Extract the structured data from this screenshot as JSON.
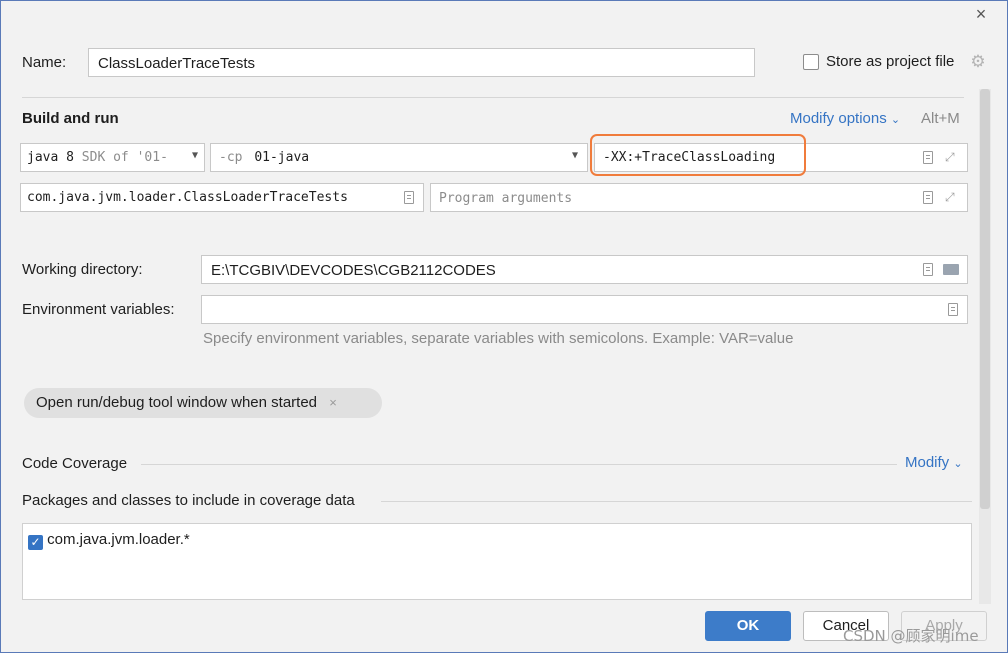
{
  "dialog": {
    "close_glyph": "×",
    "name_label": "Name:",
    "name_value": "ClassLoaderTraceTests",
    "store_label": "Store as project file"
  },
  "build_run": {
    "title": "Build and run",
    "modify_options": "Modify options",
    "shortcut": "Alt+M",
    "jre_label_a": "java 8",
    "jre_label_b": "SDK of '01-",
    "classpath_prefix": "-cp",
    "classpath_value": "01-java",
    "vm_options": "-XX:+TraceClassLoading",
    "main_class": "com.java.jvm.loader.ClassLoaderTraceTests",
    "program_args_placeholder": "Program arguments"
  },
  "working_dir": {
    "label": "Working directory:",
    "value": "E:\\TCGBIV\\DEVCODES\\CGB2112CODES"
  },
  "env_vars": {
    "label": "Environment variables:",
    "value": "",
    "hint": "Specify environment variables, separate variables with semicolons. Example: VAR=value"
  },
  "chip": {
    "label": "Open run/debug tool window when started",
    "close": "×"
  },
  "coverage": {
    "title": "Code Coverage",
    "modify": "Modify",
    "packages_label": "Packages and classes to include in coverage data",
    "items": [
      {
        "checked": true,
        "label": "com.java.jvm.loader.*"
      }
    ]
  },
  "footer": {
    "ok": "OK",
    "cancel": "Cancel",
    "apply": "Apply"
  },
  "watermark": "CSDN @顾家明ime",
  "colors": {
    "accent": "#3574c4",
    "ok_button": "#3d7cc9",
    "highlight_box": "#f07c3c"
  }
}
